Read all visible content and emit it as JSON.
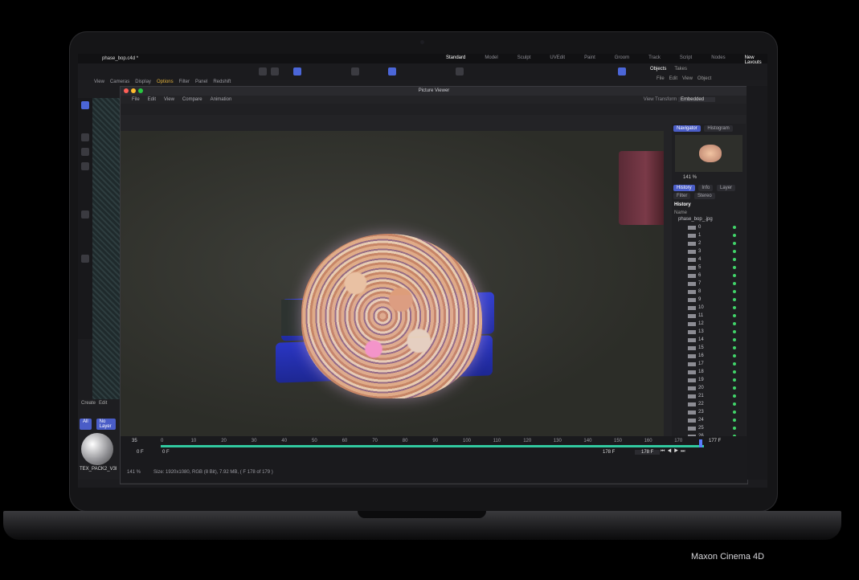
{
  "app": {
    "file_name": "phase_bop.c4d *",
    "layouts": [
      "Standard",
      "Model",
      "Sculpt",
      "UVEdit",
      "Paint",
      "Groom",
      "Track",
      "Script",
      "Nodes"
    ],
    "new_layouts": "New Layouts"
  },
  "viewport_menu": [
    "View",
    "Cameras",
    "Display",
    "Options",
    "Filter",
    "Panel",
    "Redshift"
  ],
  "objects_tabs": [
    "Objects",
    "Takes"
  ],
  "objects_menu": [
    "File",
    "Edit",
    "View",
    "Object"
  ],
  "picture_viewer": {
    "title": "Picture Viewer",
    "menu": [
      "File",
      "Edit",
      "View",
      "Compare",
      "Animation"
    ],
    "view_transform_label": "View Transform",
    "view_transform_value": "Embedded",
    "side_tabs": [
      "Navigator",
      "Histogram"
    ],
    "zoom": "141 %",
    "info_tabs": [
      "History",
      "Info",
      "Layer",
      "Filter",
      "Stereo"
    ],
    "history_heading": "History",
    "history_col": "Name",
    "history_root": "phase_bop_.jpg",
    "frames": [
      "0",
      "1",
      "2",
      "3",
      "4",
      "5",
      "6",
      "7",
      "8",
      "9",
      "10",
      "11",
      "12",
      "13",
      "14",
      "15",
      "16",
      "17",
      "18",
      "19",
      "20",
      "21",
      "22",
      "23",
      "24",
      "25",
      "26"
    ]
  },
  "timeline": {
    "ticks": [
      "0",
      "10",
      "20",
      "30",
      "40",
      "50",
      "60",
      "70",
      "80",
      "90",
      "100",
      "110",
      "120",
      "130",
      "140",
      "150",
      "160",
      "170"
    ],
    "start_frame": "0 F",
    "left_value": "35",
    "current_frame": "178 F",
    "current_frame2": "178 F",
    "end_frame": "177 F"
  },
  "status_bar": {
    "zoom": "141 %",
    "info": "Size: 1920x1080, RGB (8 Bit), 7.92 MB,  ( F 178 of 179 )"
  },
  "material": {
    "label": "TEX_PACK2_V3l",
    "menu": [
      "Create",
      "Edit"
    ],
    "filters": [
      "All",
      "No Layer"
    ]
  },
  "caption": "Maxon Cinema 4D"
}
